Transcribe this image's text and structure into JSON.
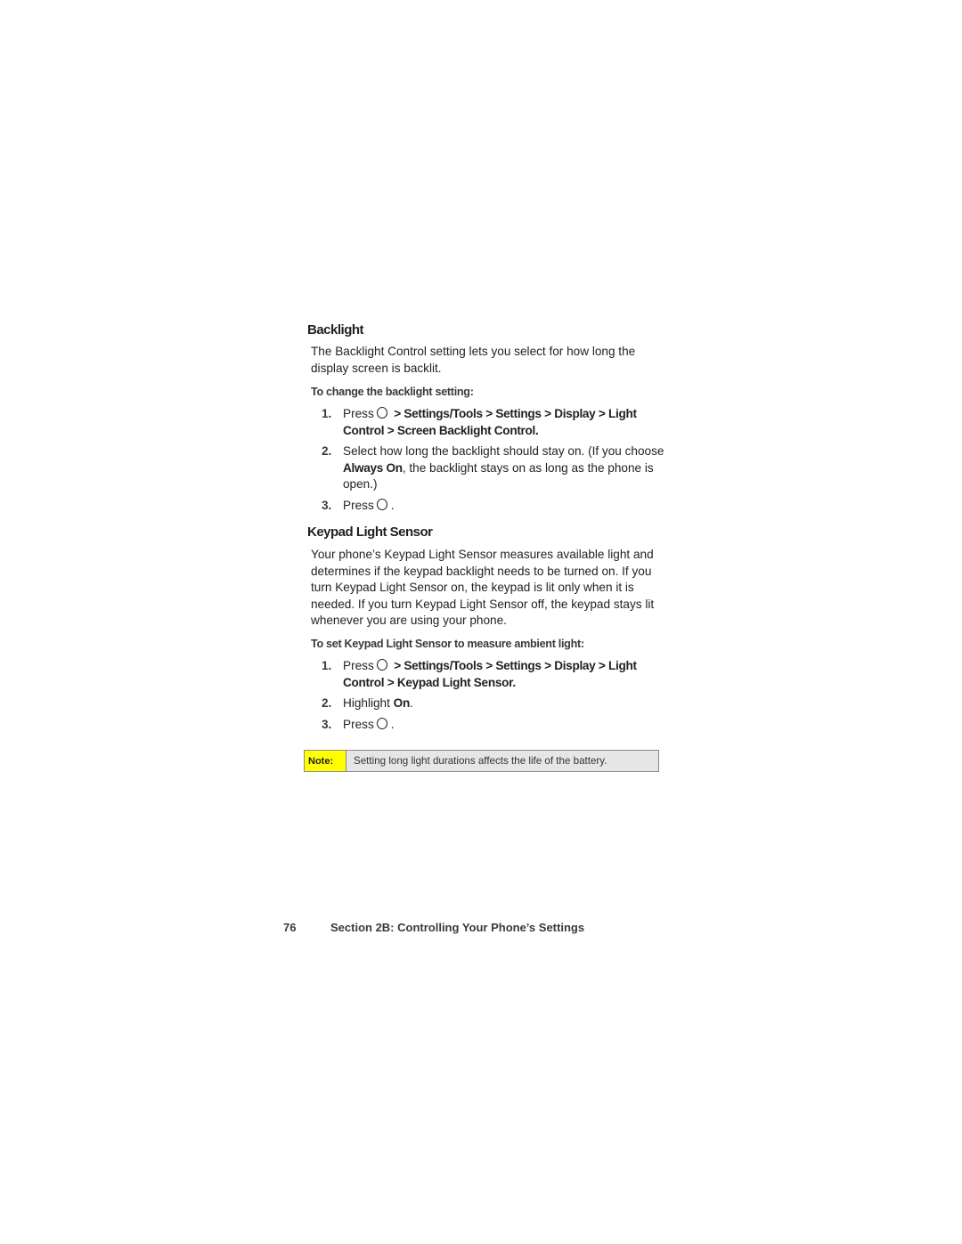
{
  "backlight": {
    "heading": "Backlight",
    "intro": "The Backlight Control setting lets you select for how long the display screen is backlit.",
    "subheading": "To change the backlight setting:",
    "steps": [
      {
        "num": "1.",
        "pre": "Press",
        "path": " > Settings/Tools > Settings > Display > Light Control > Screen Backlight Control."
      },
      {
        "num": "2.",
        "pre": "Select how long the backlight should stay on. (If you choose ",
        "bold": "Always On",
        "post": ", the backlight stays on as long as the phone is open.)"
      },
      {
        "num": "3.",
        "pre": "Press",
        "post": "."
      }
    ]
  },
  "keypad": {
    "heading": "Keypad Light Sensor",
    "intro": "Your phone’s Keypad Light Sensor measures available light and determines if the keypad backlight needs to be turned on. If you turn Keypad Light Sensor on, the keypad is lit only when it is needed. If you turn Keypad Light Sensor off, the keypad stays lit whenever you are using your phone.",
    "subheading": "To set Keypad Light Sensor to measure ambient light:",
    "steps": [
      {
        "num": "1.",
        "pre": "Press",
        "path": " > Settings/Tools > Settings > Display > Light Control > Keypad Light Sensor."
      },
      {
        "num": "2.",
        "pre": "Highlight ",
        "bold": "On",
        "post": "."
      },
      {
        "num": "3.",
        "pre": "Press",
        "post": "."
      }
    ]
  },
  "note": {
    "label": "Note:",
    "text": "Setting long light durations affects the life of the battery.",
    "label_color": "#ffff00"
  },
  "footer": {
    "page_number": "76",
    "section_title": "Section 2B: Controlling Your Phone’s Settings"
  },
  "icons": {
    "menu_key": "circle-key-icon"
  }
}
